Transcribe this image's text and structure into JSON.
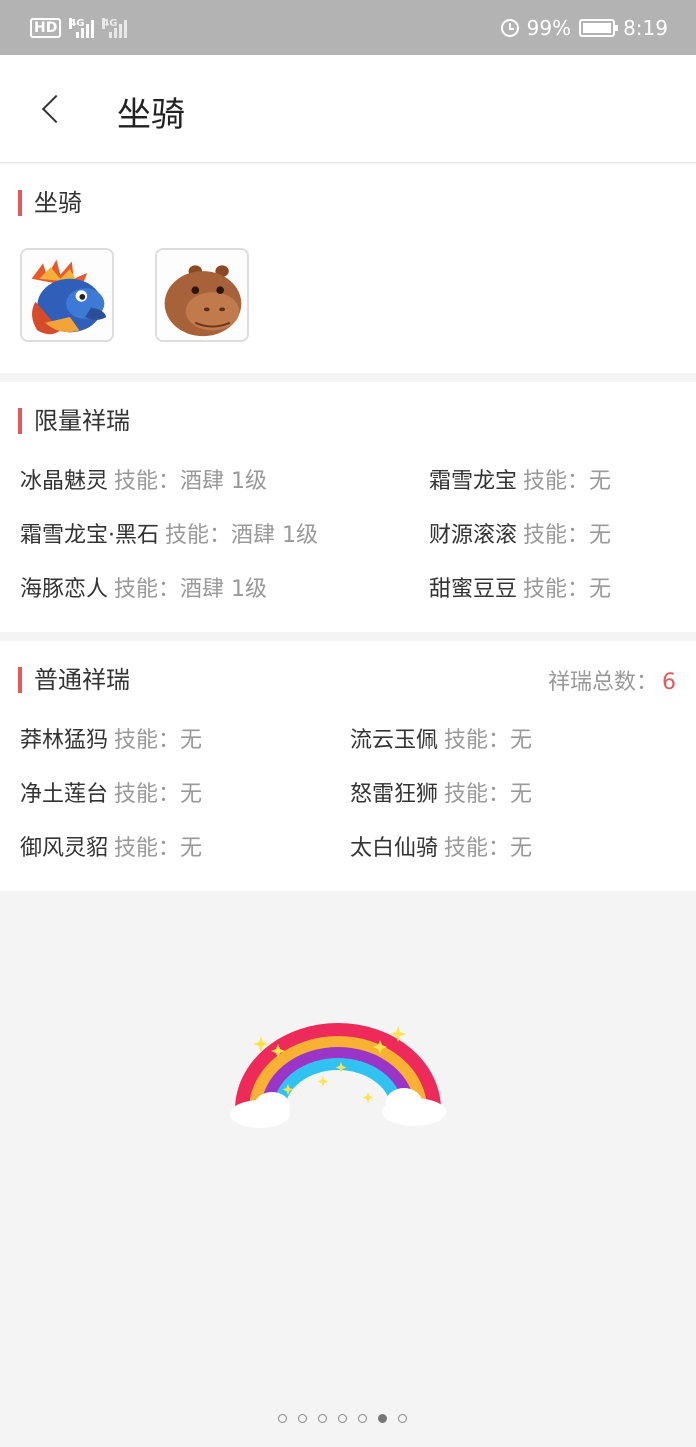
{
  "status_bar": {
    "hd": "HD",
    "net1": "4G",
    "net2": "4G",
    "battery": "99%",
    "battery_level": 0.99,
    "time": "8:19"
  },
  "header": {
    "title": "坐骑"
  },
  "mounts_section": {
    "title": "坐骑",
    "mounts": [
      {
        "icon": "dragon-mount-icon"
      },
      {
        "icon": "hippo-mount-icon"
      }
    ]
  },
  "limited_section": {
    "title": "限量祥瑞",
    "items": [
      {
        "name": "冰晶魅灵",
        "skill": "技能：酒肆 1级"
      },
      {
        "name": "霜雪龙宝",
        "skill": "技能：无"
      },
      {
        "name": "霜雪龙宝·黑石",
        "skill": "技能：酒肆 1级"
      },
      {
        "name": "财源滚滚",
        "skill": "技能：无"
      },
      {
        "name": "海豚恋人",
        "skill": "技能：酒肆 1级"
      },
      {
        "name": "甜蜜豆豆",
        "skill": "技能：无"
      }
    ]
  },
  "normal_section": {
    "title": "普通祥瑞",
    "total_label": "祥瑞总数：",
    "total_value": "6",
    "items": [
      {
        "name": "莽林猛犸",
        "skill": "技能：无"
      },
      {
        "name": "流云玉佩",
        "skill": "技能：无"
      },
      {
        "name": "净土莲台",
        "skill": "技能：无"
      },
      {
        "name": "怒雷狂狮",
        "skill": "技能：无"
      },
      {
        "name": "御风灵貂",
        "skill": "技能：无"
      },
      {
        "name": "太白仙骑",
        "skill": "技能：无"
      }
    ]
  },
  "pager": {
    "count": 7,
    "active_index": 5
  },
  "colors": {
    "accent": "#e25a5a",
    "background": "#f4f4f4"
  }
}
